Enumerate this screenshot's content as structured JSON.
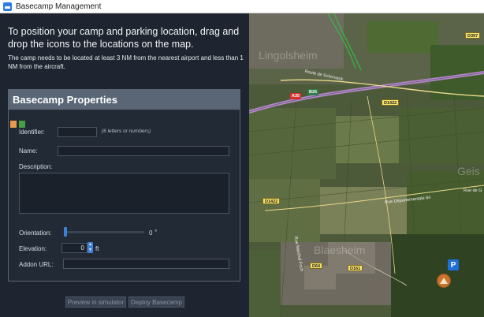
{
  "window": {
    "title": "Basecamp Management"
  },
  "intro": {
    "title": "To position your camp and parking location, drag and drop the icons to the locations on the map.",
    "subtitle": "The camp needs to be located at least 3 NM from the nearest airport and less than 1 NM from the aircraft."
  },
  "panel": {
    "title": "Basecamp Properties",
    "identifier_label": "Identifier:",
    "identifier_value": "",
    "identifier_hint": "(6 letters or numbers)",
    "name_label": "Name:",
    "name_value": "",
    "description_label": "Description:",
    "description_value": "",
    "orientation_label": "Orientation:",
    "orientation_value": "0",
    "orientation_unit": "°",
    "elevation_label": "Elevation:",
    "elevation_value": "0",
    "elevation_unit": "ft",
    "addon_label": "Addon URL:",
    "addon_value": ""
  },
  "buttons": {
    "preview": "Preview in simulator",
    "deploy": "Deploy Basecamp"
  },
  "map": {
    "badges": [
      "A35",
      "B25",
      "D1422",
      "D397",
      "D1422",
      "D64",
      "D161"
    ],
    "labels": [
      "Route de Schirmeck",
      "Rue Départementale 84",
      "Rue de G",
      "Rue Marchal Foch"
    ],
    "watermarks": [
      "Lingolsheim",
      "Geis",
      "Blaesheim"
    ],
    "parking_marker": "P",
    "colors": {
      "parking": "#1e6fd9",
      "camp": "#c8742f"
    }
  }
}
